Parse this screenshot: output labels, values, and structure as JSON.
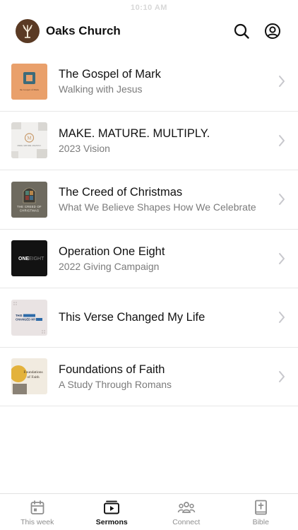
{
  "status_bar": {
    "time": "10:10 AM"
  },
  "header": {
    "title": "Oaks Church",
    "icons": {
      "search": "search-icon",
      "account": "account-circle-icon"
    }
  },
  "sermons": [
    {
      "title": "The Gospel of Mark",
      "subtitle": "Walking with Jesus",
      "thumb_caption": "the Gospel of Mark"
    },
    {
      "title": "MAKE. MATURE. MULTIPLY.",
      "subtitle": "2023 Vision",
      "thumb_caption": "MAKE. MATURE. MULTIPLY."
    },
    {
      "title": "The Creed of Christmas",
      "subtitle": "What We Believe Shapes How We Celebrate",
      "thumb_caption": "THE CREED OF CHRISTMAS"
    },
    {
      "title": "Operation One Eight",
      "subtitle": "2022 Giving Campaign",
      "thumb_caption": "ONE EIGHT"
    },
    {
      "title": "This Verse Changed My Life",
      "subtitle": "",
      "thumb_caption": "THIS VERSE CHANGED MY LIFE"
    },
    {
      "title": "Foundations of Faith",
      "subtitle": "A Study Through Romans",
      "thumb_caption": "Foundations of Faith"
    }
  ],
  "tabs": [
    {
      "label": "This week",
      "icon": "calendar-icon",
      "active": false
    },
    {
      "label": "Sermons",
      "icon": "sermons-play-icon",
      "active": true
    },
    {
      "label": "Connect",
      "icon": "people-group-icon",
      "active": false
    },
    {
      "label": "Bible",
      "icon": "bible-icon",
      "active": false
    }
  ],
  "colors": {
    "accent": "#111111",
    "inactive": "#8e8e8e",
    "divider": "#e7e7e7",
    "logo_bg": "#5a3a24"
  }
}
